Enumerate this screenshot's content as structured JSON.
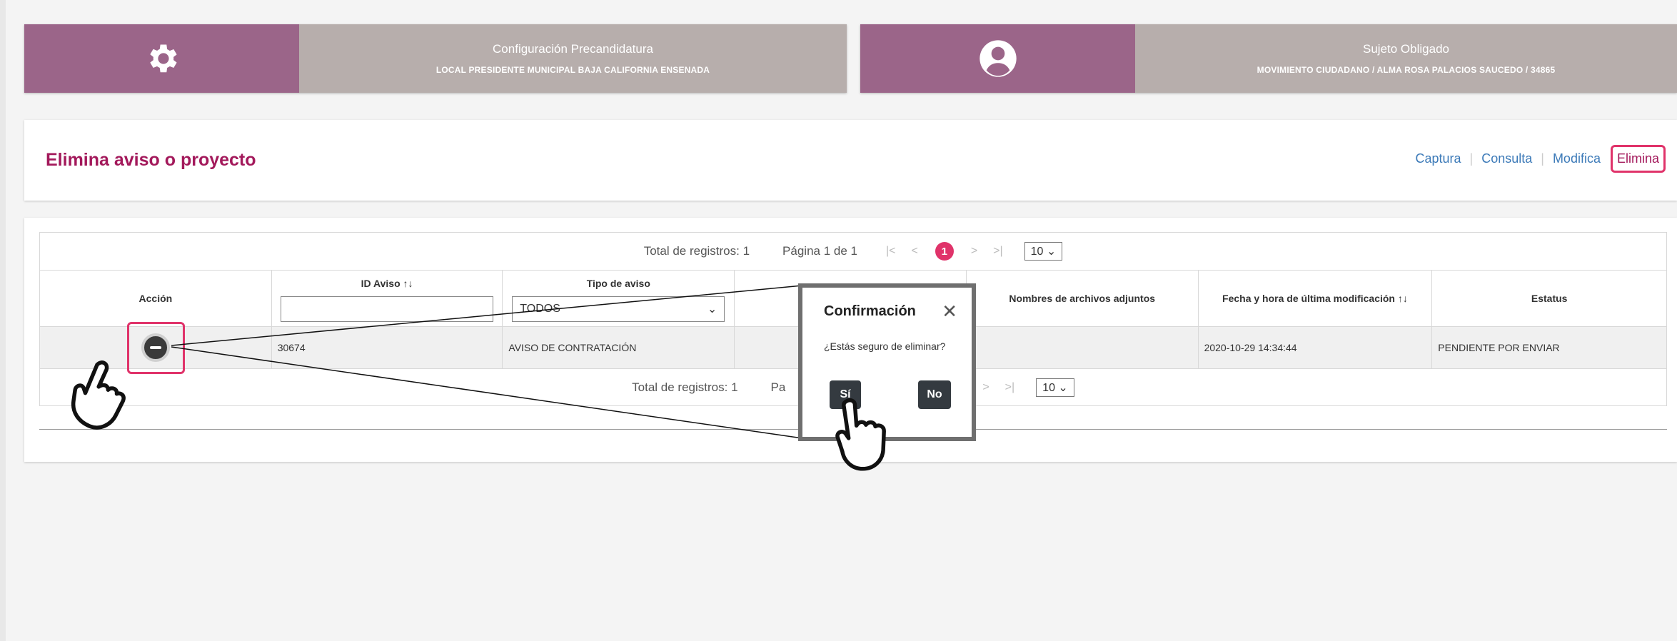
{
  "header": {
    "config": {
      "title": "Configuración Precandidatura",
      "subtitle": "LOCAL PRESIDENTE MUNICIPAL BAJA CALIFORNIA ENSENADA"
    },
    "subject": {
      "title": "Sujeto Obligado",
      "subtitle": "MOVIMIENTO CIUDADANO / ALMA ROSA PALACIOS SAUCEDO / 34865"
    }
  },
  "page": {
    "title": "Elimina aviso o proyecto",
    "nav": [
      "Captura",
      "Consulta",
      "Modifica",
      "Elimina"
    ],
    "active_nav": "Elimina"
  },
  "pager_top": {
    "total": "Total de registros: 1",
    "page": "Página 1 de 1",
    "current": "1",
    "per_page": "10"
  },
  "pager_bottom": {
    "total": "Total de registros: 1",
    "page": "Pa",
    "per_page": "10"
  },
  "table": {
    "headers": {
      "accion": "Acción",
      "id_aviso": "ID Aviso",
      "tipo_aviso": "Tipo de aviso",
      "adjuntos": "Nombres de archivos adjuntos",
      "fecha": "Fecha y hora de última modificación",
      "estatus": "Estatus"
    },
    "filter_tipo": "TODOS",
    "row": {
      "id_aviso": "30674",
      "tipo_aviso": "AVISO DE CONTRATACIÓN",
      "fecha": "2020-10-29 14:34:44",
      "estatus": "PENDIENTE POR ENVIAR"
    }
  },
  "dialog": {
    "title": "Confirmación",
    "message": "¿Estás seguro de eliminar?",
    "yes": "Sí",
    "no": "No"
  },
  "icons": [
    "gear-icon",
    "user-circle-icon",
    "sort-icon",
    "chevron-down-icon",
    "close-icon",
    "remove-icon",
    "hand-pointer-icon"
  ],
  "colors": {
    "brand": "#9b6589",
    "accent": "#e0336a",
    "title": "#a3195b",
    "link": "#3c7ab8"
  }
}
